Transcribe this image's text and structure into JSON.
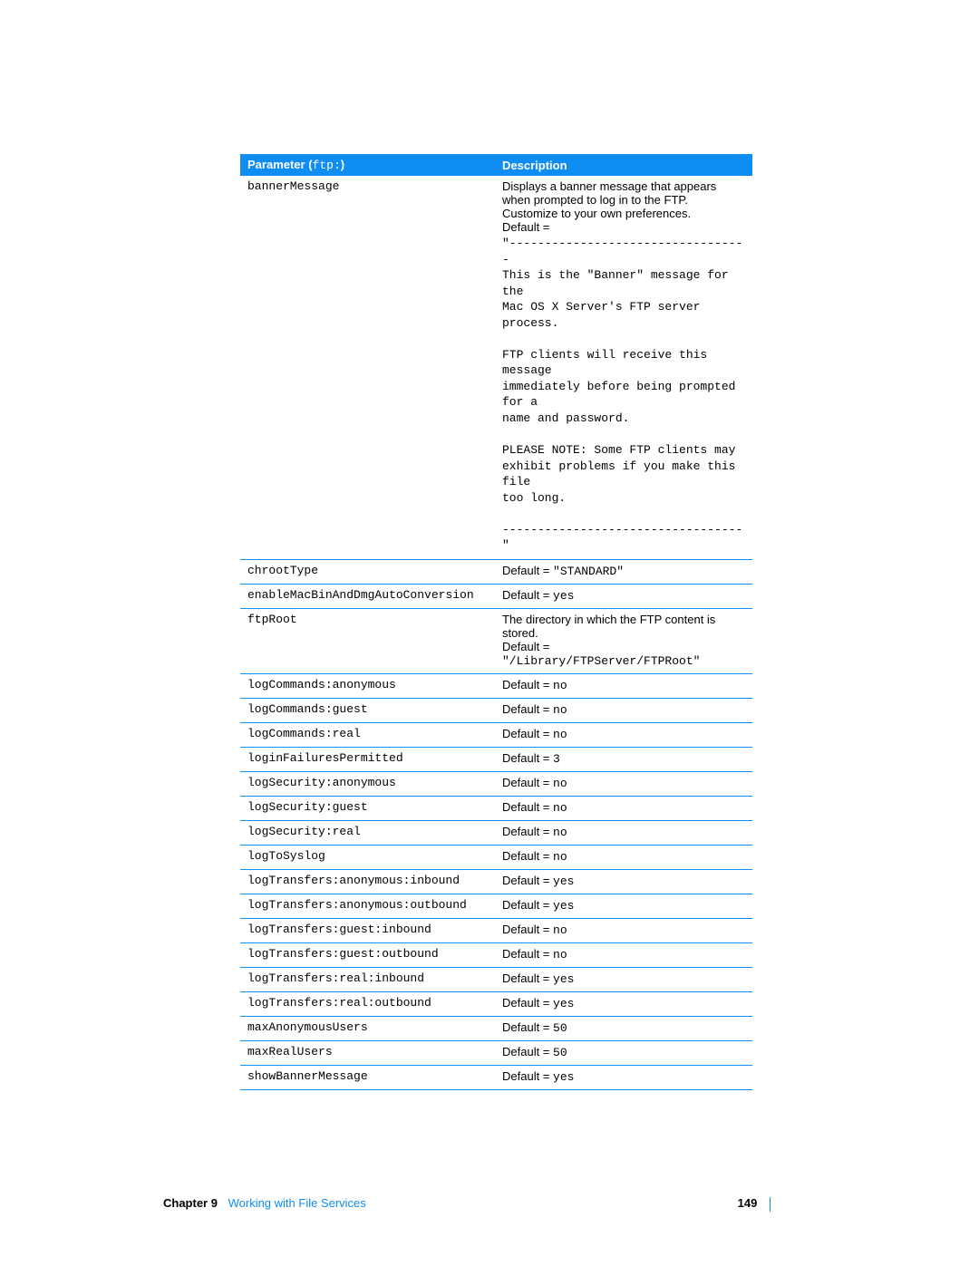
{
  "header": {
    "param_label": "Parameter (",
    "param_prefix": "ftp:",
    "param_label_close": ")",
    "desc_label": "Description"
  },
  "rows": [
    {
      "param": "bannerMessage",
      "desc_plain": "Displays a banner message that appears when prompted to log in to the FTP. Customize to your own preferences.",
      "default_text": "Default = ",
      "default_mono": "",
      "block": "\"----------------------------------\nThis is the \"Banner\" message for the\nMac OS X Server's FTP server process.\n\nFTP clients will receive this message\nimmediately before being prompted for a\nname and password.\n\nPLEASE NOTE: Some FTP clients may\nexhibit problems if you make this file\ntoo long.\n\n----------------------------------\""
    },
    {
      "param": "chrootType",
      "default_text": "Default = ",
      "default_mono": "\"STANDARD\""
    },
    {
      "param": "enableMacBinAndDmgAutoConversion",
      "default_text": "Default = ",
      "default_mono": "yes"
    },
    {
      "param": "ftpRoot",
      "desc_plain": "The directory in which the FTP content is stored.",
      "default_text": "Default = ",
      "default_mono": "\"/Library/FTPServer/FTPRoot\""
    },
    {
      "param": "logCommands:anonymous",
      "default_text": "Default = ",
      "default_mono": "no"
    },
    {
      "param": "logCommands:guest",
      "default_text": "Default = ",
      "default_mono": "no"
    },
    {
      "param": "logCommands:real",
      "default_text": "Default = ",
      "default_mono": "no"
    },
    {
      "param": "loginFailuresPermitted",
      "default_text": "Default = ",
      "default_mono": "3"
    },
    {
      "param": "logSecurity:anonymous",
      "default_text": "Default = ",
      "default_mono": "no"
    },
    {
      "param": "logSecurity:guest",
      "default_text": "Default = ",
      "default_mono": "no"
    },
    {
      "param": "logSecurity:real",
      "default_text": "Default = ",
      "default_mono": "no"
    },
    {
      "param": "logToSyslog",
      "default_text": "Default = ",
      "default_mono": "no"
    },
    {
      "param": "logTransfers:anonymous:inbound",
      "default_text": "Default = ",
      "default_mono": "yes"
    },
    {
      "param": "logTransfers:anonymous:outbound",
      "default_text": "Default = ",
      "default_mono": "yes"
    },
    {
      "param": "logTransfers:guest:inbound",
      "default_text": "Default = ",
      "default_mono": "no"
    },
    {
      "param": "logTransfers:guest:outbound",
      "default_text": "Default = ",
      "default_mono": "no"
    },
    {
      "param": "logTransfers:real:inbound",
      "default_text": "Default = ",
      "default_mono": "yes"
    },
    {
      "param": "logTransfers:real:outbound",
      "default_text": "Default = ",
      "default_mono": "yes"
    },
    {
      "param": "maxAnonymousUsers",
      "default_text": "Default = ",
      "default_mono": "50"
    },
    {
      "param": "maxRealUsers",
      "default_text": "Default = ",
      "default_mono": "50"
    },
    {
      "param": "showBannerMessage",
      "default_text": "Default = ",
      "default_mono": "yes"
    }
  ],
  "footer": {
    "chapter_label": "Chapter 9",
    "chapter_title": "Working with File Services",
    "page": "149"
  }
}
